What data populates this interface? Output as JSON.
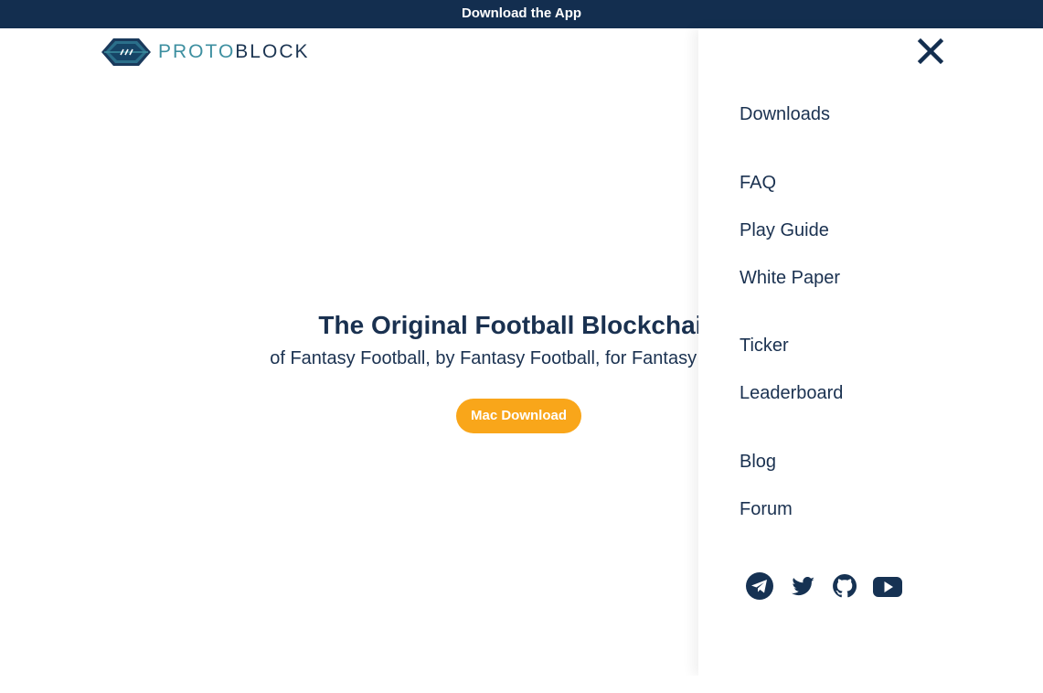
{
  "banner": {
    "label": "Download the App"
  },
  "logo": {
    "part1": "PROTO",
    "part2": "BLOCK"
  },
  "hero": {
    "title": "The Original Football Blockchain",
    "subtitle": "of Fantasy Football, by Fantasy Football, for Fantasy Football",
    "button_label": "Mac Download"
  },
  "menu": {
    "close_icon": "close-icon",
    "items": [
      {
        "label": "Downloads"
      },
      {
        "label": "FAQ"
      },
      {
        "label": "Play Guide"
      },
      {
        "label": "White Paper"
      },
      {
        "label": "Ticker"
      },
      {
        "label": "Leaderboard"
      },
      {
        "label": "Blog"
      },
      {
        "label": "Forum"
      }
    ],
    "social": [
      "telegram-icon",
      "twitter-icon",
      "github-icon",
      "youtube-icon"
    ]
  },
  "colors": {
    "navy": "#132e4f",
    "text": "#1a3150",
    "accent": "#f9a61a",
    "logo_teal": "#3d8fa0"
  }
}
